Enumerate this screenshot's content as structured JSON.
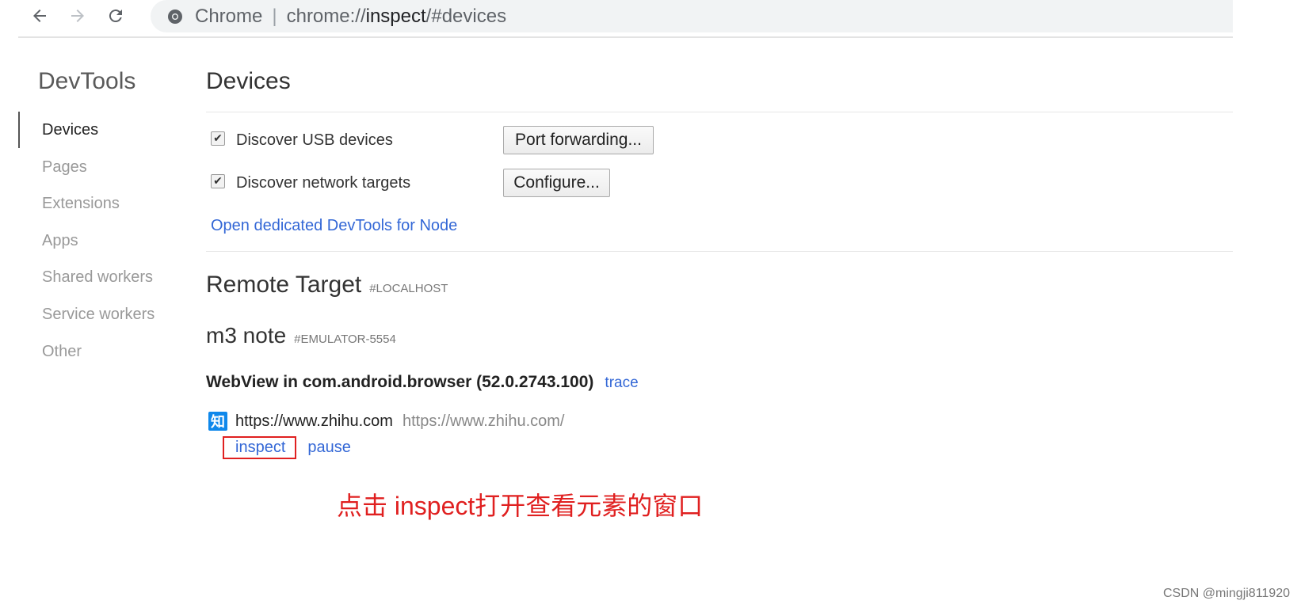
{
  "browser": {
    "site_name": "Chrome",
    "url_separator": "|",
    "url_scheme": "chrome://",
    "url_host": "inspect",
    "url_rest": "/#devices"
  },
  "sidebar": {
    "title": "DevTools",
    "items": [
      {
        "label": "Devices"
      },
      {
        "label": "Pages"
      },
      {
        "label": "Extensions"
      },
      {
        "label": "Apps"
      },
      {
        "label": "Shared workers"
      },
      {
        "label": "Service workers"
      },
      {
        "label": "Other"
      }
    ]
  },
  "main": {
    "title": "Devices",
    "options": [
      {
        "label": "Discover USB devices",
        "checked": true,
        "button": "Port forwarding..."
      },
      {
        "label": "Discover network targets",
        "checked": true,
        "button": "Configure..."
      }
    ],
    "node_link": "Open dedicated DevTools for Node",
    "remote_target": {
      "title": "Remote Target",
      "sub": "#LOCALHOST"
    },
    "device": {
      "title": "m3 note",
      "sub": "#EMULATOR-5554"
    },
    "webview": {
      "label": "WebView in com.android.browser (52.0.2743.100)",
      "trace": "trace"
    },
    "page": {
      "favicon_char": "知",
      "title": "https://www.zhihu.com",
      "url": "https://www.zhihu.com/",
      "inspect": "inspect",
      "pause": "pause"
    }
  },
  "annotation": "点击 inspect打开查看元素的窗口",
  "watermark": "CSDN @mingji811920",
  "colors": {
    "link": "#3367d6",
    "annotation": "#e02020",
    "favicon": "#0f88eb"
  }
}
